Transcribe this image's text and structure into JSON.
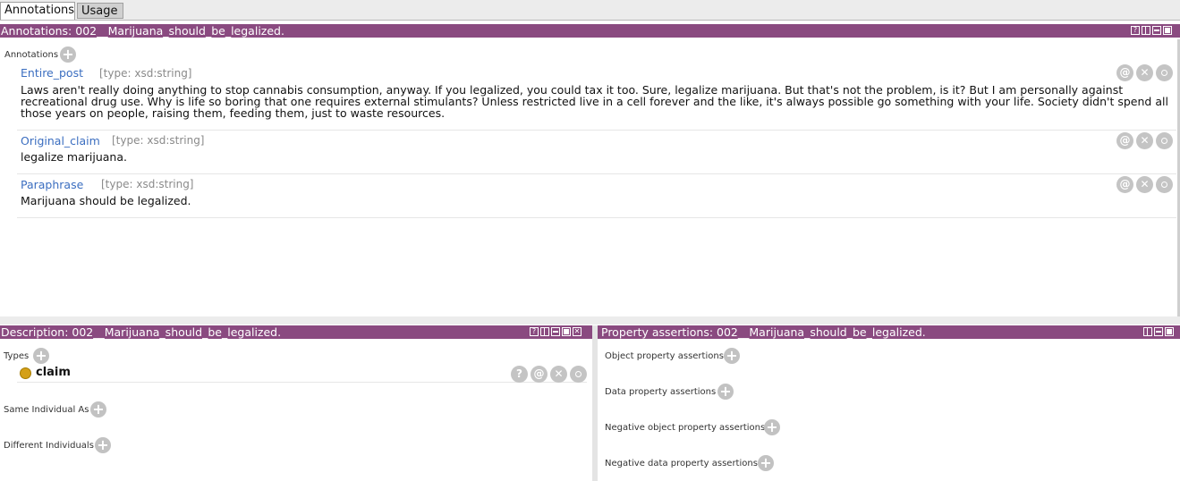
{
  "tabs": [
    {
      "label": "Annotations",
      "active": true
    },
    {
      "label": "Usage",
      "active": false
    }
  ],
  "annotations_panel": {
    "title": "Annotations: 002__Marijuana_should_be_legalized.",
    "section_label": "Annotations",
    "rows": [
      {
        "property": "Entire_post",
        "type": "[type: xsd:string]",
        "lines": [
          "Laws aren't really doing anything to stop cannabis consumption, anyway. If you legalized, you could tax it too. Sure, legalize marijuana. But that's not the problem, is it? But I am personally against",
          "recreational drug use. Why is life so boring that one requires external stimulants? Unless restricted live in a cell forever and the like, it's always possible go something with your life. Society didn't spend all",
          "those years on people, raising them, feeding them, just to waste resources."
        ]
      },
      {
        "property": "Original_claim",
        "type": "[type: xsd:string]",
        "lines": [
          "legalize marijuana."
        ]
      },
      {
        "property": "Paraphrase",
        "type": "[type: xsd:string]",
        "lines": [
          "Marijuana should be legalized."
        ]
      }
    ]
  },
  "description_panel": {
    "title": "Description: 002__Marijuana_should_be_legalized.",
    "types_label": "Types",
    "type_item": "claim",
    "same_individual_label": "Same Individual As",
    "different_individuals_label": "Different Individuals"
  },
  "property_panel": {
    "title": "Property assertions: 002__Marijuana_should_be_legalized.",
    "object_label": "Object property assertions",
    "data_label": "Data property assertions",
    "neg_object_label": "Negative object property assertions",
    "neg_data_label": "Negative data property assertions"
  },
  "colors": {
    "titlebar": "#8a4a80",
    "property_link": "#3b6ec0",
    "class_bullet": "#d4a017"
  },
  "icons": {
    "title_help": "help-icon",
    "title_split": "split-icon",
    "title_minimize": "minimize-icon",
    "title_maximize": "maximize-icon",
    "title_close": "close-icon",
    "add": "plus-icon",
    "annotate": "at-icon",
    "delete": "x-icon",
    "edit": "circle-icon"
  }
}
